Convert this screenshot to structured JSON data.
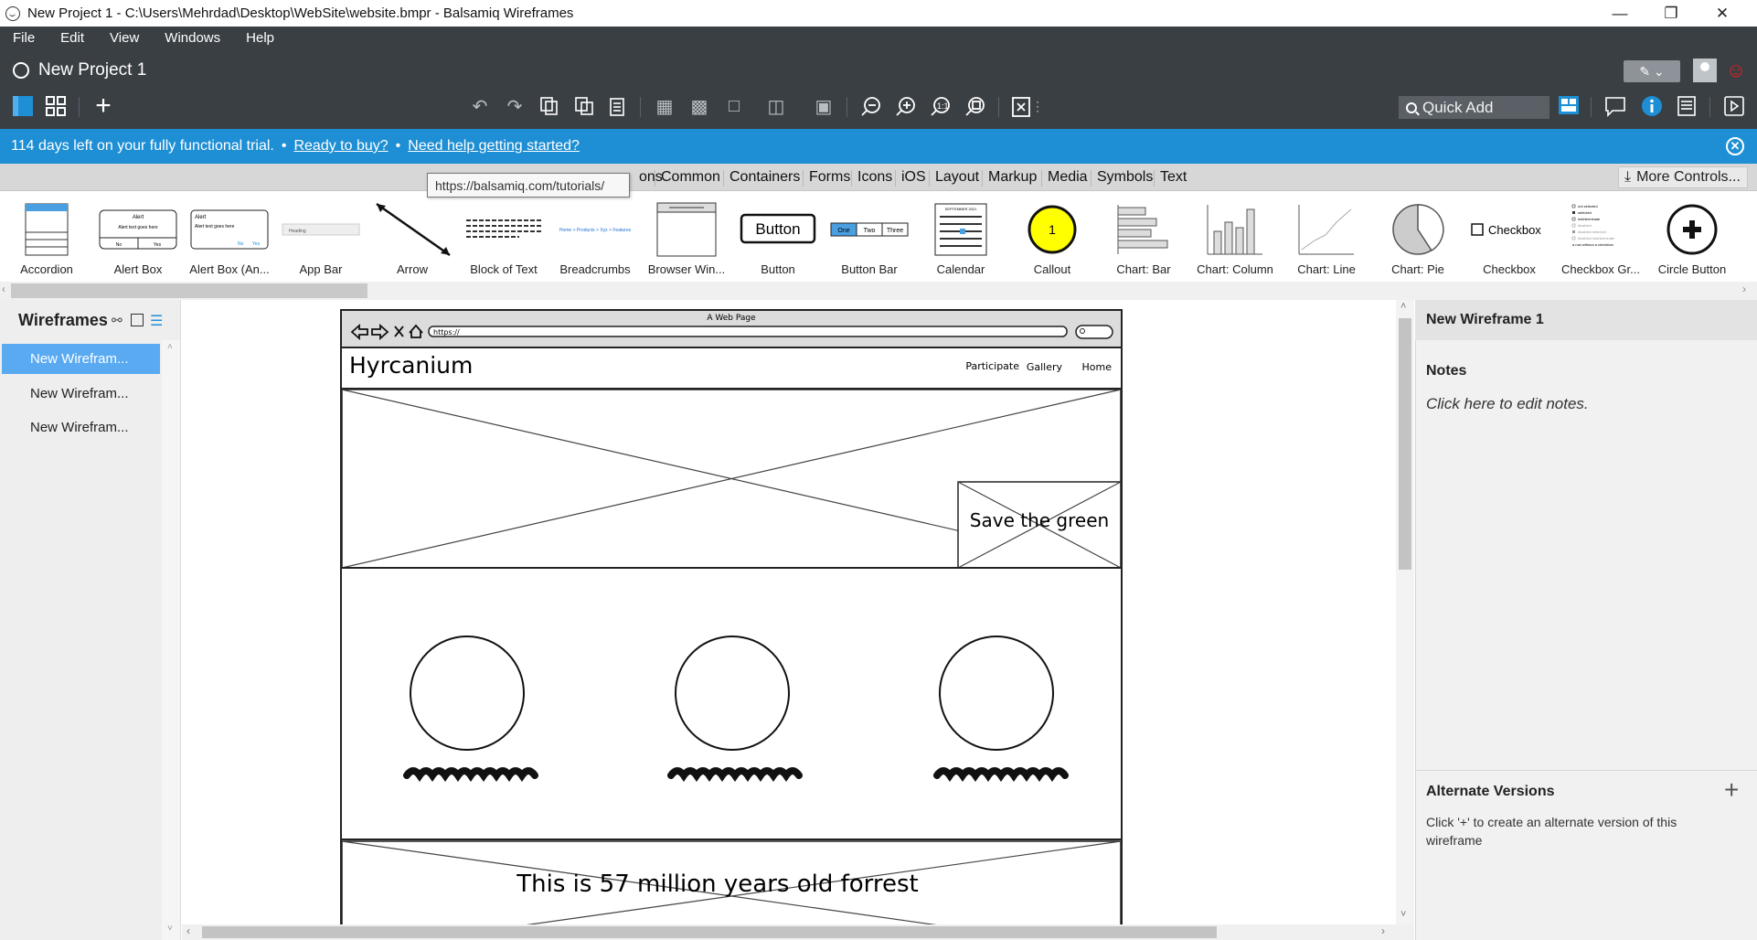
{
  "window": {
    "title": "New Project 1 - C:\\Users\\Mehrdad\\Desktop\\WebSite\\website.bmpr - Balsamiq Wireframes"
  },
  "menu": [
    "File",
    "Edit",
    "View",
    "Windows",
    "Help"
  ],
  "project": {
    "title": "New Project 1"
  },
  "toolbar": {
    "quick_add": "Quick Add"
  },
  "trial": {
    "message": "114 days left on your fully functional trial.",
    "bullet": "•",
    "link_buy": "Ready to buy?",
    "link_help": "Need help getting started?"
  },
  "library": {
    "tooltip": "https://balsamiq.com/tutorials/",
    "partial_tab": "ons",
    "tabs": [
      "Common",
      "Containers",
      "Forms",
      "Icons",
      "iOS",
      "Layout",
      "Markup",
      "Media",
      "Symbols",
      "Text"
    ],
    "more_controls": "More Controls..."
  },
  "components": [
    "Accordion",
    "Alert Box",
    "Alert Box (An...",
    "App Bar",
    "Arrow",
    "Block of Text",
    "Breadcrumbs",
    "Browser Win...",
    "Button",
    "Button Bar",
    "Calendar",
    "Callout",
    "Chart: Bar",
    "Chart: Column",
    "Chart: Line",
    "Chart: Pie",
    "Checkbox",
    "Checkbox Gr...",
    "Circle Button"
  ],
  "component_thumbs": {
    "alert_title": "Alert",
    "alert_text": "Alert text goes here",
    "alert_no": "No",
    "alert_yes": "Yes",
    "appbar_heading": "Heading",
    "breadcrumbs_text": "Home > Products > Xyz > Features",
    "button_text": "Button",
    "buttonbar": [
      "One",
      "Two",
      "Three"
    ],
    "calendar_header": "SEPTEMBER 2021",
    "callout_number": "1",
    "checkbox_text": "Checkbox",
    "checkbox_group": [
      "not selected",
      "selected",
      "indeterminate",
      "disabled",
      "disabled selected",
      "disabled indeterminate",
      "a row without a checkbox"
    ]
  },
  "left_panel": {
    "header": "Wireframes",
    "items": [
      {
        "label": "New Wirefram...",
        "selected": true
      },
      {
        "label": "New Wirefram...",
        "selected": false
      },
      {
        "label": "New Wirefram...",
        "selected": false
      }
    ]
  },
  "wireframe": {
    "browser_title": "A Web Page",
    "url": "https://",
    "site_title": "Hyrcanium",
    "nav": [
      "Participate",
      "Gallery",
      "Home"
    ],
    "callout_text": "Save the green",
    "footer_text": "This is 57 million years old forrest"
  },
  "right_panel": {
    "wireframe_name": "New Wireframe 1",
    "notes_label": "Notes",
    "notes_placeholder": "Click here to edit notes.",
    "alt_label": "Alternate Versions",
    "alt_text": "Click '+' to create an alternate version of this wireframe"
  },
  "colors": {
    "dark_chrome": "#3a3f44",
    "trial_bar": "#1e8fd4",
    "selected_item": "#5aaaf2",
    "callout_yellow": "#ffff00"
  }
}
